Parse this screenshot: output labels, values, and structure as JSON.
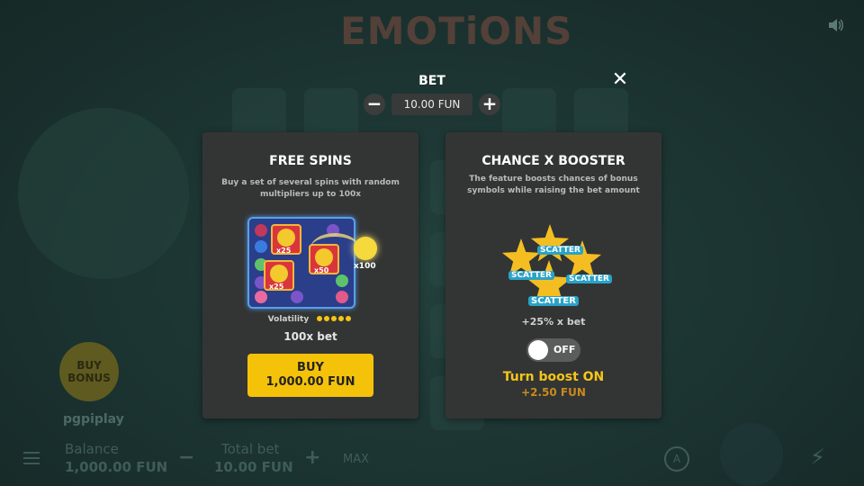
{
  "game": {
    "logo_text": "EMOTiONS",
    "brand": "pgpiplay",
    "buy_bonus_label": "BUY BONUS",
    "balance_label": "Balance",
    "balance_value": "1,000.00 FUN",
    "total_bet_label": "Total bet",
    "total_bet_value": "10.00 FUN",
    "max_label": "MAX",
    "auto_label": "A"
  },
  "bet": {
    "title": "BET",
    "value": "10.00 FUN",
    "minus_label": "−",
    "plus_label": "+"
  },
  "close_label": "✕",
  "free_spins": {
    "title": "FREE SPINS",
    "description": "Buy a set of several spins with random multipliers up to 100x",
    "multipliers": [
      "x25",
      "x50",
      "x25",
      "x100"
    ],
    "volatility_label": "Volatility",
    "volatility_level": 5,
    "volatility_max": 5,
    "cost_multiplier": "100x bet",
    "buy_label": "BUY",
    "buy_price": "1,000.00 FUN"
  },
  "booster": {
    "title": "CHANCE X BOOSTER",
    "description": "The feature boosts chances of bonus symbols while raising the bet amount",
    "scatter_label": "SCATTER",
    "bet_increase": "+25% x bet",
    "toggle_state": "OFF",
    "turn_on_label": "Turn boost ON",
    "extra_cost": "+2.50 FUN"
  },
  "colors": {
    "accent_yellow": "#f5c20a",
    "card_bg": "#333534",
    "cost_orange": "#c88a1c"
  }
}
